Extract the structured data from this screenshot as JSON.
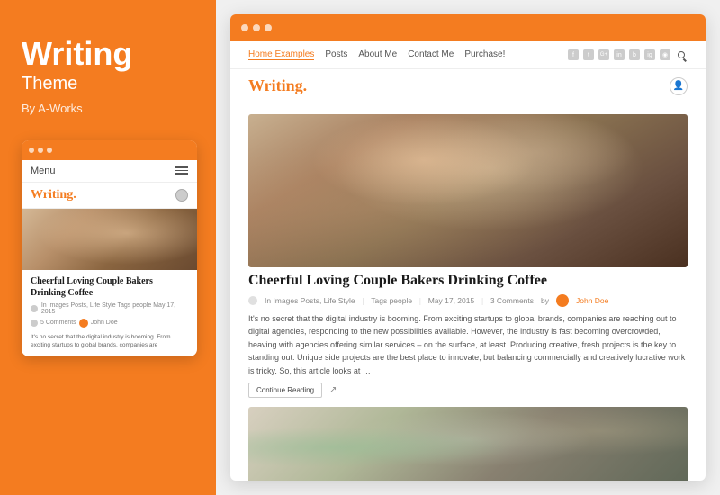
{
  "left": {
    "title": "Writing",
    "subtitle": "Theme",
    "by": "By A-Works",
    "mobile": {
      "menu_label": "Menu",
      "logo": "Writing",
      "logo_dot": ".",
      "article_title": "Cheerful Loving Couple Bakers Drinking Coffee",
      "meta": "In Images Posts, Life Style  Tags people  May 17, 2015",
      "comments": "5 Comments",
      "author": "John Doe",
      "body_text": "It's no secret that the digital industry is booming. From exciting startups to global brands, companies are"
    }
  },
  "right": {
    "nav": {
      "links": [
        "Home Examples",
        "Posts",
        "About Me",
        "Contact Me",
        "Purchase!"
      ],
      "social_icons": [
        "f",
        "t",
        "G+",
        "in",
        "b",
        "ig",
        "rss"
      ],
      "active_link": "Home Examples"
    },
    "logo": "Writing",
    "logo_dot": ".",
    "article1": {
      "title": "Cheerful Loving Couple Bakers Drinking Coffee",
      "meta_in": "In Images Posts, Life Style",
      "meta_tags": "Tags people",
      "meta_date": "May 17, 2015",
      "meta_comments": "3 Comments",
      "author": "John Doe",
      "body": "It's no secret that the digital industry is booming. From exciting startups to global brands, companies are reaching out to digital agencies, responding to the new possibilities available. However, the industry is fast becoming overcrowded, heaving with agencies offering similar services – on the surface, at least. Producing creative, fresh projects is the key to standing out. Unique side projects are the best place to innovate, but balancing commercially and creatively lucrative work is tricky. So, this article looks at …",
      "continue_label": "Continue Reading"
    }
  },
  "colors": {
    "orange": "#f47c20",
    "dark_text": "#1a1a1a",
    "muted": "#888888",
    "link_orange": "#f47c20"
  }
}
